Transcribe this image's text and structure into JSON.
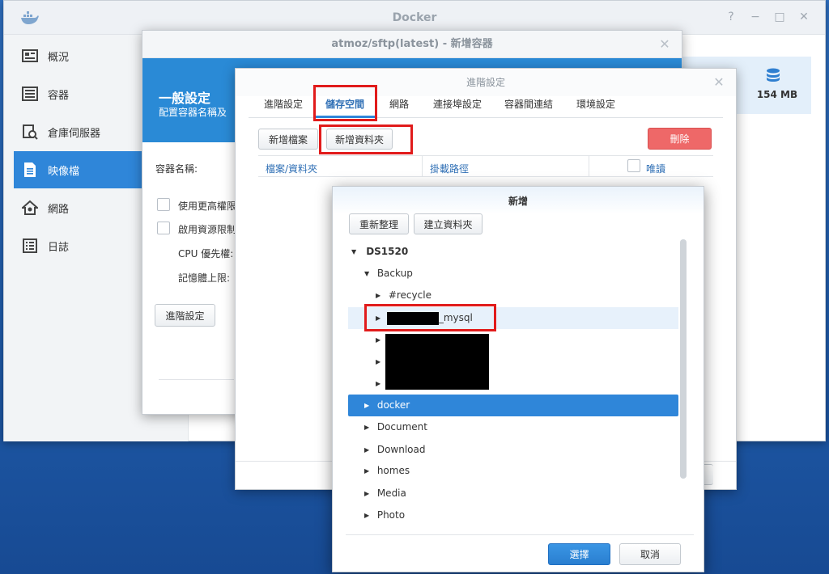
{
  "docker": {
    "title": "Docker",
    "window_controls": [
      "?",
      "−",
      "□",
      "✕"
    ],
    "sidebar": [
      {
        "label": "概況",
        "icon": "overview-icon"
      },
      {
        "label": "容器",
        "icon": "container-icon"
      },
      {
        "label": "倉庫伺服器",
        "icon": "registry-icon"
      },
      {
        "label": "映像檔",
        "icon": "image-icon",
        "active": true
      },
      {
        "label": "網路",
        "icon": "network-icon"
      },
      {
        "label": "日誌",
        "icon": "log-icon"
      }
    ],
    "storage_value": "154 MB"
  },
  "wizard": {
    "title": "atmoz/sftp(latest) - 新增容器",
    "banner_title": "一般設定",
    "banner_sub": "配置容器名稱及",
    "container_name_label": "容器名稱:",
    "privilege_label": "使用更高權限",
    "resource_label": "啟用資源限制",
    "cpu_label": "CPU 優先權:",
    "memory_label": "記憶體上限:",
    "advanced_button": "進階設定"
  },
  "advanced": {
    "title": "進階設定",
    "tabs": [
      "進階設定",
      "儲存空間",
      "網路",
      "連接埠設定",
      "容器間連結",
      "環境設定"
    ],
    "active_tab": "儲存空間",
    "add_file_button": "新增檔案",
    "add_folder_button": "新增資料夾",
    "delete_button": "刪除",
    "columns": {
      "file_folder": "檔案/資料夾",
      "mount_path": "掛載路徑",
      "readonly": "唯讀"
    }
  },
  "picker": {
    "title": "新增",
    "refresh_button": "重新整理",
    "create_folder_button": "建立資料夾",
    "tree": [
      {
        "label": "DS1520",
        "caret": "▼",
        "bold": true
      },
      {
        "label": "Backup",
        "caret": "▼"
      },
      {
        "label": "#recycle",
        "caret": "▶"
      },
      {
        "label": "_mysql",
        "caret": "▶"
      },
      {
        "label": "",
        "caret": "▶"
      },
      {
        "label": "",
        "caret": "▶"
      },
      {
        "label": "",
        "caret": "▶"
      },
      {
        "label": "docker",
        "caret": "▶",
        "selected": true
      },
      {
        "label": "Document",
        "caret": "▶"
      },
      {
        "label": "Download",
        "caret": "▶"
      },
      {
        "label": "homes",
        "caret": "▶"
      },
      {
        "label": "Media",
        "caret": "▶"
      },
      {
        "label": "Photo",
        "caret": "▶"
      }
    ],
    "select_button": "選擇",
    "cancel_button": "取消"
  },
  "colors": {
    "accent": "#2f86d9",
    "highlight_frame": "#e11b1b",
    "delete": "#ee6868",
    "desktop": "#1f5aa8"
  }
}
